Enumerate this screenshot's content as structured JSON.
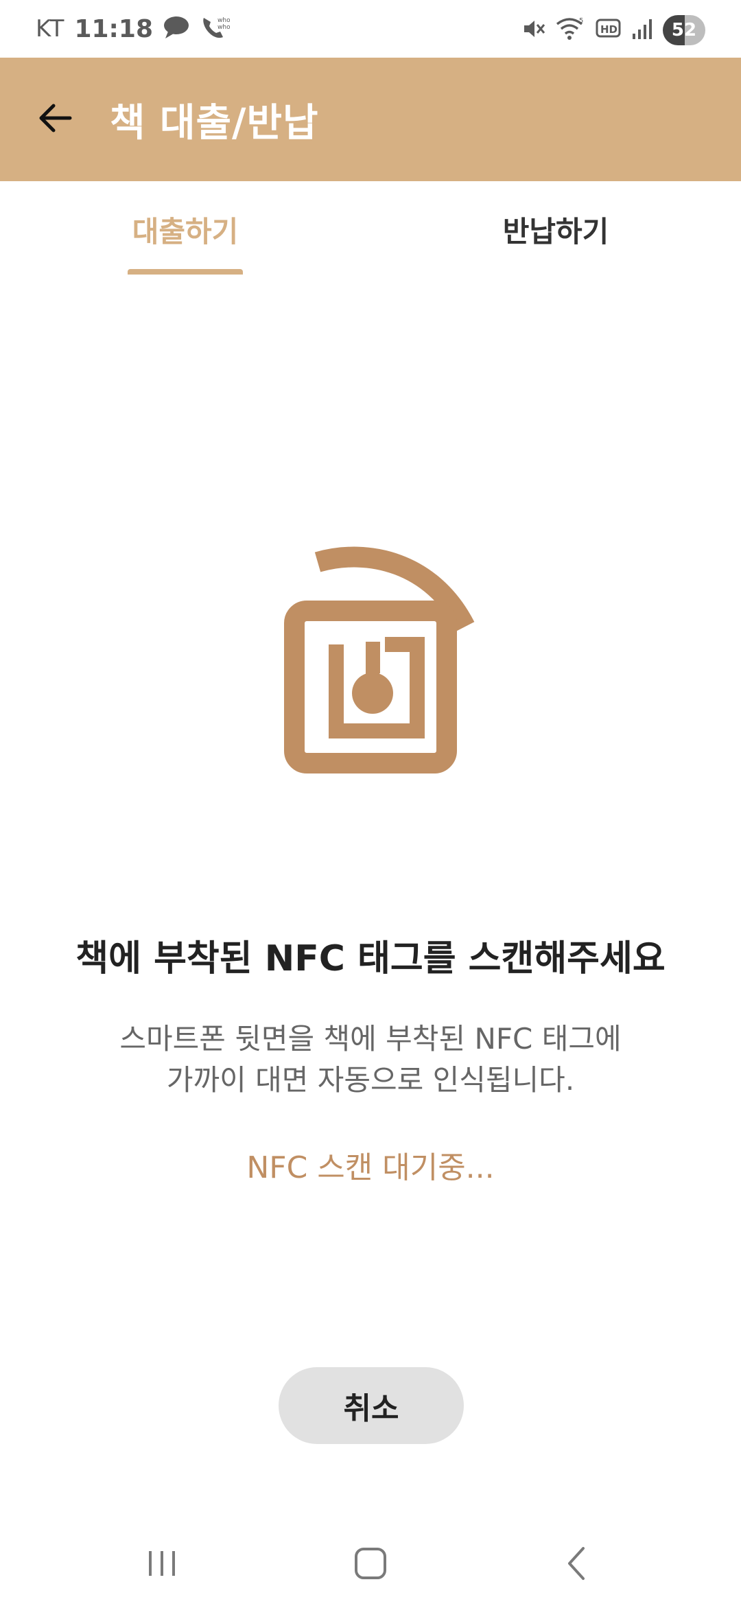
{
  "status_bar": {
    "carrier": "KT",
    "time": "11:18",
    "battery": "52",
    "icons": [
      "chat-bubble-icon",
      "whowho-call-icon",
      "mute-icon",
      "wifi-icon",
      "hd-icon",
      "signal-icon"
    ]
  },
  "app_bar": {
    "title": "책 대출/반납",
    "background_color": "#d6b083",
    "back_icon": "arrow-left-icon"
  },
  "tabs": [
    {
      "label": "대출하기",
      "selected": true
    },
    {
      "label": "반납하기",
      "selected": false
    }
  ],
  "nfc": {
    "icon": "nfc-tag-icon",
    "color": "#c08f63",
    "title": "책에 부착된 NFC 태그를 스캔해주세요",
    "description_line1": "스마트폰 뒷면을 책에 부착된 NFC 태그에",
    "description_line2": "가까이 대면 자동으로 인식됩니다.",
    "status": "NFC 스캔 대기중..."
  },
  "cancel_button": {
    "label": "취소"
  },
  "nav_bar": {
    "icons": [
      "recent-apps-icon",
      "home-icon",
      "back-icon"
    ]
  }
}
